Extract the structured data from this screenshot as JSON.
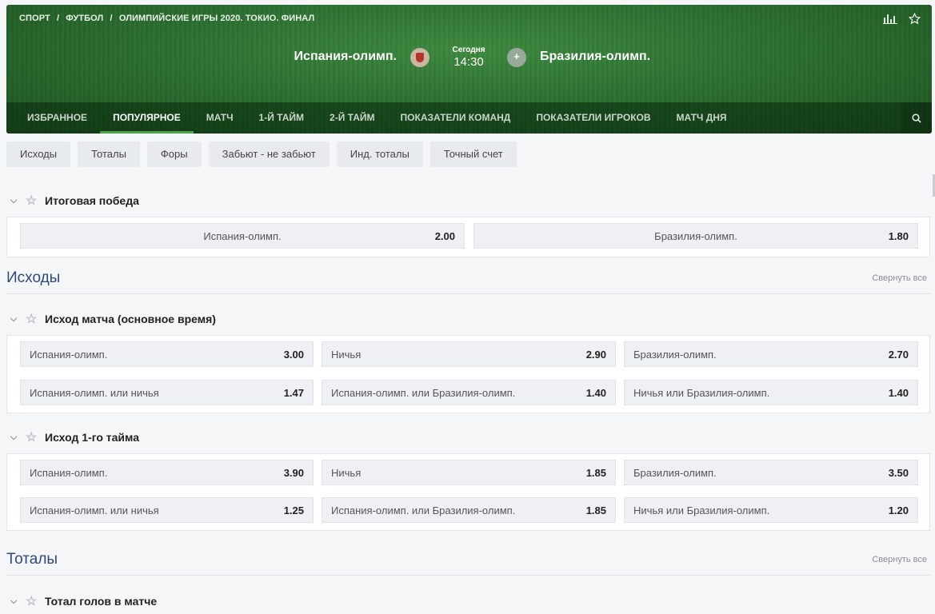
{
  "breadcrumbs": [
    "СПОРТ",
    "/",
    "ФУТБОЛ",
    "/",
    "ОЛИМПИЙСКИЕ ИГРЫ 2020. ТОКИО. ФИНАЛ"
  ],
  "match": {
    "home": "Испания-олимп.",
    "away": "Бразилия-олимп.",
    "day": "Сегодня",
    "time": "14:30"
  },
  "tabs": [
    {
      "label": "ИЗБРАННОЕ",
      "active": false
    },
    {
      "label": "ПОПУЛЯРНОЕ",
      "active": true
    },
    {
      "label": "МАТЧ",
      "active": false
    },
    {
      "label": "1-Й ТАЙМ",
      "active": false
    },
    {
      "label": "2-Й ТАЙМ",
      "active": false
    },
    {
      "label": "ПОКАЗАТЕЛИ КОМАНД",
      "active": false
    },
    {
      "label": "ПОКАЗАТЕЛИ ИГРОКОВ",
      "active": false
    },
    {
      "label": "МАТЧ ДНЯ",
      "active": false
    }
  ],
  "chips": [
    "Исходы",
    "Тоталы",
    "Форы",
    "Забьют - не забьют",
    "Инд. тоталы",
    "Точный счет"
  ],
  "final_win": {
    "title": "Итоговая победа",
    "home": {
      "label": "Испания-олимп.",
      "odd": "2.00"
    },
    "away": {
      "label": "Бразилия-олимп.",
      "odd": "1.80"
    }
  },
  "sections": {
    "outcomes": {
      "title": "Исходы",
      "collapse": "Свернуть все"
    },
    "totals": {
      "title": "Тоталы",
      "collapse": "Свернуть все"
    }
  },
  "match_result": {
    "title": "Исход матча (основное время)",
    "rows": [
      [
        {
          "label": "Испания-олимп.",
          "odd": "3.00"
        },
        {
          "label": "Ничья",
          "odd": "2.90"
        },
        {
          "label": "Бразилия-олимп.",
          "odd": "2.70"
        }
      ],
      [
        {
          "label": "Испания-олимп. или ничья",
          "odd": "1.47"
        },
        {
          "label": "Испания-олимп. или Бразилия-олимп.",
          "odd": "1.40"
        },
        {
          "label": "Ничья или Бразилия-олимп.",
          "odd": "1.40"
        }
      ]
    ]
  },
  "first_half": {
    "title": "Исход 1-го тайма",
    "rows": [
      [
        {
          "label": "Испания-олимп.",
          "odd": "3.90"
        },
        {
          "label": "Ничья",
          "odd": "1.85"
        },
        {
          "label": "Бразилия-олимп.",
          "odd": "3.50"
        }
      ],
      [
        {
          "label": "Испания-олимп. или ничья",
          "odd": "1.25"
        },
        {
          "label": "Испания-олимп. или Бразилия-олимп.",
          "odd": "1.85"
        },
        {
          "label": "Ничья или Бразилия-олимп.",
          "odd": "1.20"
        }
      ]
    ]
  },
  "total_goals": {
    "title": "Тотал голов в матче"
  }
}
